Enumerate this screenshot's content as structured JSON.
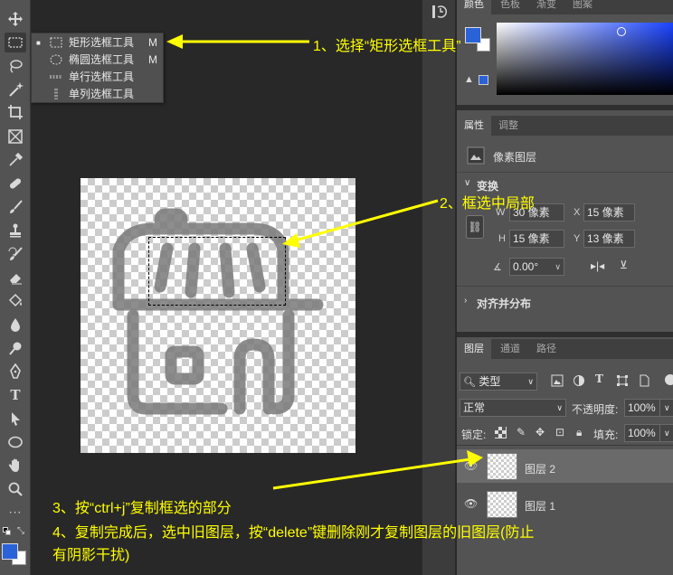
{
  "flyout": {
    "items": [
      {
        "label": "矩形选框工具",
        "shortcut": "M",
        "selected": true,
        "icon": "rect-marquee-icon"
      },
      {
        "label": "椭圆选框工具",
        "shortcut": "M",
        "selected": false,
        "icon": "elliptical-marquee-icon"
      },
      {
        "label": "单行选框工具",
        "shortcut": "",
        "selected": false,
        "icon": "single-row-marquee-icon"
      },
      {
        "label": "单列选框工具",
        "shortcut": "",
        "selected": false,
        "icon": "single-column-marquee-icon"
      }
    ]
  },
  "color_panel": {
    "tabs": [
      "颜色",
      "色板",
      "渐变",
      "图案"
    ],
    "foreground": "#2a62d8",
    "background": "#ffffff"
  },
  "properties_panel": {
    "tabs": [
      "属性",
      "调整"
    ],
    "layer_type": "像素图层",
    "transform_title": "变换",
    "w_label": "W",
    "w_value": "30 像素",
    "x_label": "X",
    "x_value": "15 像素",
    "h_label": "H",
    "h_value": "15 像素",
    "y_label": "Y",
    "y_value": "13 像素",
    "angle_value": "0.00°",
    "align_title": "对齐并分布"
  },
  "layers_panel": {
    "tabs": [
      "图层",
      "通道",
      "路径"
    ],
    "filter_label": "类型",
    "blend_mode": "正常",
    "opacity_label": "不透明度:",
    "opacity_value": "100%",
    "lock_label": "锁定:",
    "fill_label": "填充:",
    "fill_value": "100%",
    "layers": [
      {
        "name": "图层 2",
        "selected": true
      },
      {
        "name": "图层 1",
        "selected": false
      }
    ]
  },
  "annotations": {
    "step1": "1、选择“矩形选框工具”",
    "step2": "2、框选中局部",
    "step3": "3、按“ctrl+j”复制框选的部分",
    "step4_line1": "4、复制完成后，选中旧图层，按“delete”键删除刚才复制图层的旧图层(防止",
    "step4_line2": "有阴影干扰)",
    "color": "#ffff00"
  },
  "toolbar": {
    "tools": [
      "move-icon",
      "marquee-icon",
      "lasso-icon",
      "magic-wand-icon",
      "crop-icon",
      "frame-icon",
      "eyedropper-icon",
      "healing-icon",
      "brush-icon",
      "stamp-icon",
      "history-brush-icon",
      "eraser-icon",
      "paint-bucket-icon",
      "blur-icon",
      "dodge-icon",
      "pen-icon",
      "type-icon",
      "path-select-icon",
      "ellipse-icon",
      "hand-icon",
      "zoom-icon",
      "more-icon"
    ]
  }
}
